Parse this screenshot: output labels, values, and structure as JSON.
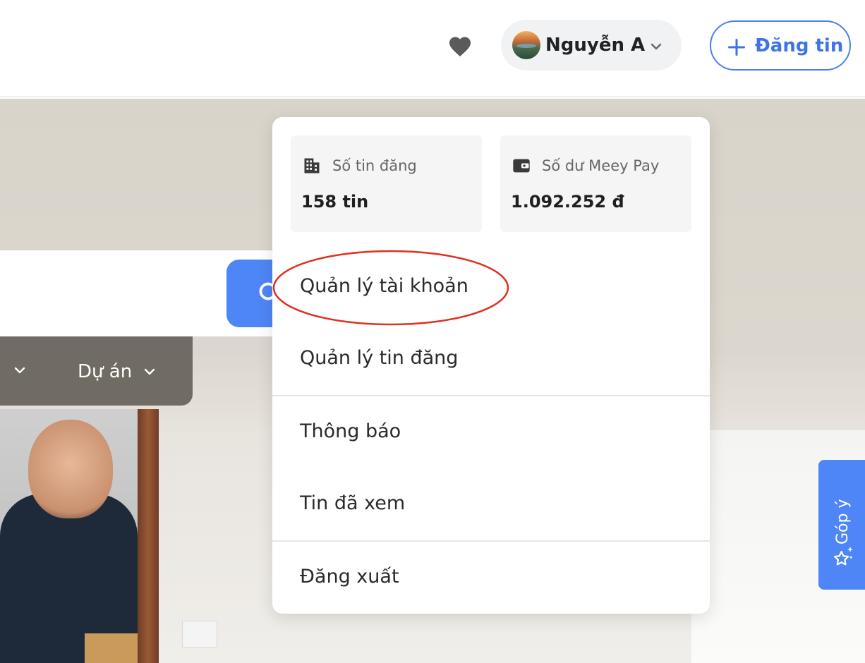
{
  "header": {
    "user_name": "Nguyễn A",
    "post_button_label": "Đăng tin",
    "icons": {
      "favorite": "heart-icon",
      "user_menu": "chevron-down-icon",
      "post": "plus-icon"
    }
  },
  "hero": {
    "filter_bar": {
      "project_label": "Dự án"
    }
  },
  "dropdown": {
    "stats": {
      "posts": {
        "label": "Số tin đăng",
        "value": "158 tin",
        "icon": "building-icon"
      },
      "wallet": {
        "label": "Số dư Meey Pay",
        "value": "1.092.252 đ",
        "icon": "wallet-icon"
      }
    },
    "items": [
      {
        "label": "Quản lý tài khoản"
      },
      {
        "label": "Quản lý tin đăng"
      },
      {
        "label": "Thông báo"
      },
      {
        "label": "Tin đã xem"
      },
      {
        "label": "Đăng xuất"
      }
    ]
  },
  "feedback_tab": {
    "label": "Góp ý",
    "icon": "sparkle-star-icon"
  },
  "colors": {
    "accent": "#4f86f7",
    "post_border": "#4a7ff0",
    "highlight": "#e0301e",
    "filter_bar": "#706b63"
  }
}
